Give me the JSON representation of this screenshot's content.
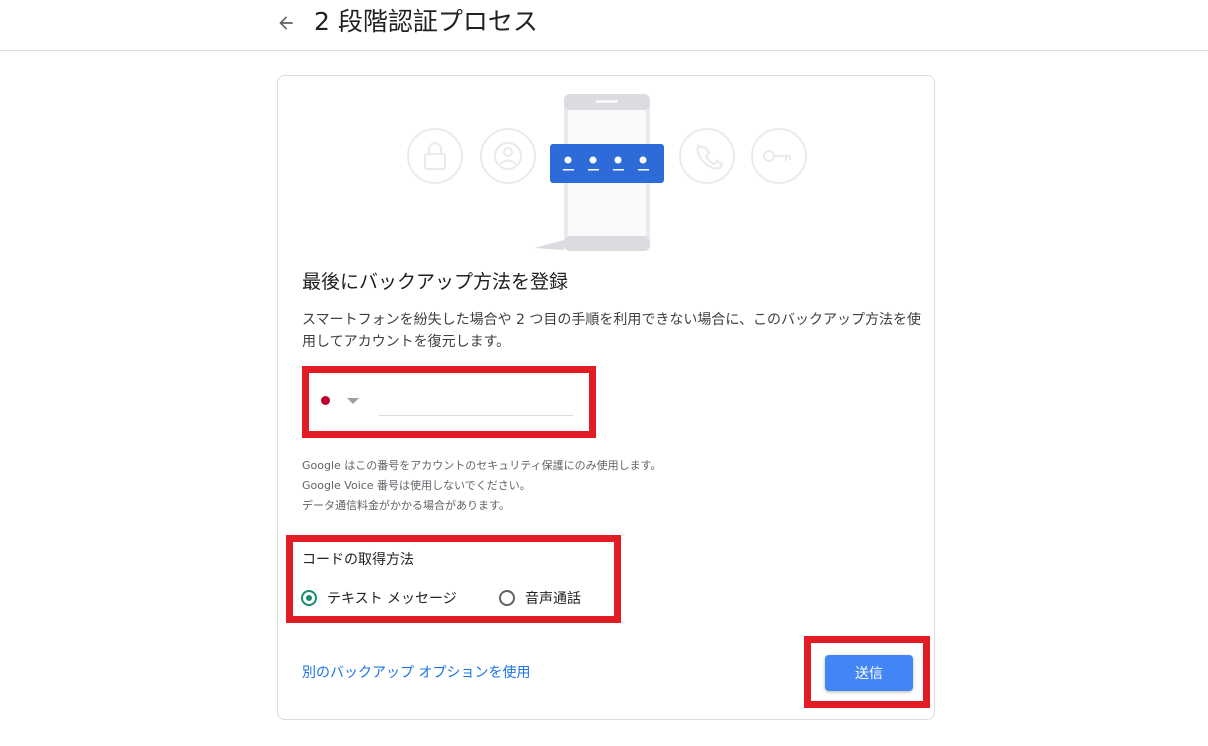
{
  "header": {
    "title": "2 段階認証プロセス",
    "back_icon": "arrow-back-icon"
  },
  "card": {
    "heading": "最後にバックアップ方法を登録",
    "description": "スマートフォンを紛失した場合や 2 つ目の手順を利用できない場合に、このバックアップ方法を使用してアカウントを復元します。",
    "phone": {
      "country_flag_color": "#bc002d",
      "value": "",
      "placeholder": ""
    },
    "notes": [
      "Google はこの番号をアカウントのセキュリティ保護にのみ使用します。",
      "Google Voice 番号は使用しないでください。",
      "データ通信料金がかかる場合があります。"
    ],
    "code_method": {
      "label": "コードの取得方法",
      "options": [
        {
          "label": "テキスト メッセージ",
          "selected": true
        },
        {
          "label": "音声通話",
          "selected": false
        }
      ]
    },
    "alt_link": "別のバックアップ オプションを使用",
    "send_button": "送信",
    "code_dots": "••••"
  },
  "colors": {
    "accent": "#4285f4",
    "highlight": "#e11c24",
    "radio_selected": "#1a8b73",
    "link": "#1a73e8"
  }
}
